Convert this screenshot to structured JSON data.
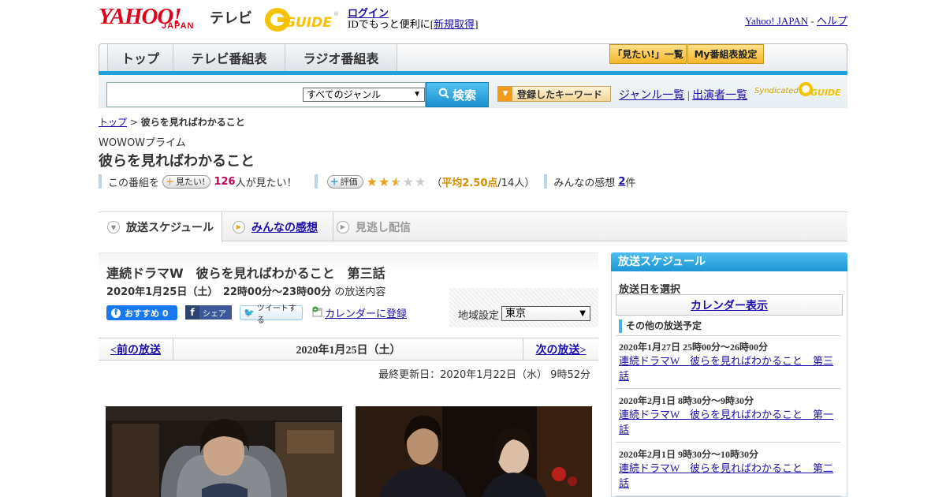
{
  "header": {
    "yahoo_logo": "YAHOO!",
    "japan_logo": "JAPAN",
    "tv_label": "テレビ",
    "gguide_logo": "G-GUIDE",
    "login_link": "ログイン",
    "login_sub_prefix": "IDでもっと便利に[",
    "signup_link": "新規取得",
    "login_sub_suffix": "]",
    "yahoo_japan_link": "Yahoo! JAPAN",
    "separator": "-",
    "help_link": "ヘルプ"
  },
  "nav": {
    "tabs": [
      "トップ",
      "テレビ番組表",
      "ラジオ番組表"
    ],
    "want_list_btn": "「見たい!」一覧",
    "my_schedule_btn": "My番組表設定"
  },
  "search": {
    "genre_select": "すべてのジャンル",
    "search_btn": "検索",
    "keyword_btn": "登録したキーワード",
    "genre_list_link": "ジャンル一覧",
    "links_sep": "|",
    "performer_list_link": "出演者一覧",
    "syndicated": "Syndicated"
  },
  "breadcrumb": {
    "top_link": "トップ",
    "sep": ">",
    "current": "彼らを見ればわかること"
  },
  "program": {
    "channel": "WOWOWプライム",
    "title": "彼らを見ればわかること",
    "want_prefix": "この番組を",
    "want_btn": "見たい!",
    "want_count": "126",
    "want_suffix": "人が見たい！",
    "rating_btn": "評価",
    "rating_open": "（",
    "rating_avg": "平均2.50点",
    "rating_people": "/14人）",
    "rating_stars": 2.5,
    "impressions_prefix": "みんなの感想",
    "impressions_count": "2",
    "impressions_suffix": "件"
  },
  "subtabs": {
    "schedule": "放送スケジュール",
    "impressions": "みんなの感想",
    "missed": "見逃し配信"
  },
  "episode": {
    "title": "連続ドラマW　彼らを見ればわかること　第三話",
    "time_bold": "2020年1月25日（土）　22時00分～23時00分",
    "time_suffix": "の放送内容",
    "fb_like": "おすすめ 0",
    "fb_share": "シェア",
    "tweet": "ツイートする",
    "calendar_link": "カレンダーに登録",
    "region_label": "地域設定",
    "region_value": "東京",
    "prev": "<前の放送",
    "date": "2020年1月25日（土）",
    "next": "次の放送>",
    "updated": "最終更新日：2020年1月22日（水） 9時52分"
  },
  "sidebar": {
    "heading": "放送スケジュール",
    "select_date": "放送日を選択",
    "calendar_btn": "カレンダー表示",
    "other_heading": "その他の放送予定",
    "schedules": [
      {
        "date": "2020年1月27日 25時00分～26時00分",
        "title": "連続ドラマW　彼らを見ればわかること　第三話"
      },
      {
        "date": "2020年2月1日 8時30分～9時30分",
        "title": "連続ドラマW　彼らを見ればわかること　第一話"
      },
      {
        "date": "2020年2月1日 9時30分～10時30分",
        "title": "連続ドラマW　彼らを見ればわかること　第二話"
      }
    ]
  },
  "colors": {
    "accent_blue": "#22a0d8",
    "yahoo_red": "#e0001a",
    "gguide_yellow": "#f5c200",
    "star_gold": "#e9a21d"
  }
}
